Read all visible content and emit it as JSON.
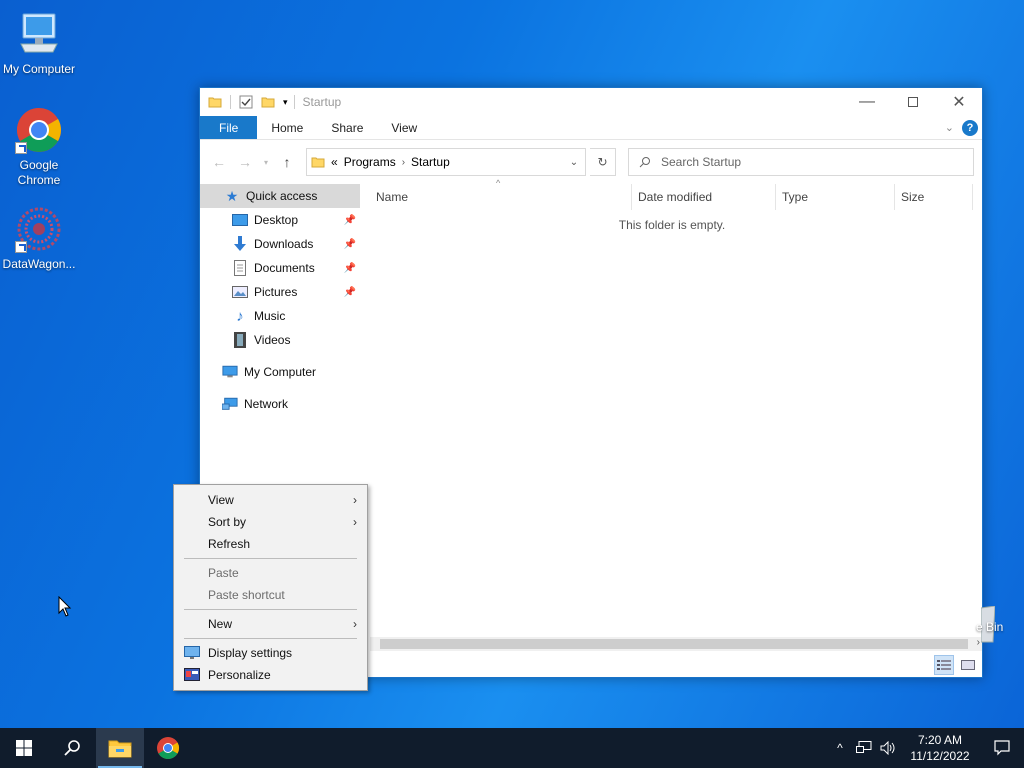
{
  "desktop": {
    "icons": [
      {
        "label": "My Computer"
      },
      {
        "label": "Google Chrome"
      },
      {
        "label": "DataWagon..."
      }
    ],
    "recycle_bin_peek": "e Bin"
  },
  "explorer": {
    "title": "Startup",
    "ribbon_tabs": [
      "File",
      "Home",
      "Share",
      "View"
    ],
    "help_label": "?",
    "breadcrumb": {
      "overflow": "«",
      "parent": "Programs",
      "current": "Startup"
    },
    "search_placeholder": "Search Startup",
    "nav": {
      "quick_access": "Quick access",
      "desktop": "Desktop",
      "downloads": "Downloads",
      "documents": "Documents",
      "pictures": "Pictures",
      "music": "Music",
      "videos": "Videos",
      "my_computer": "My Computer",
      "network": "Network"
    },
    "columns": [
      "Name",
      "Date modified",
      "Type",
      "Size"
    ],
    "empty_message": "This folder is empty."
  },
  "context_menu": {
    "view": "View",
    "sort_by": "Sort by",
    "refresh": "Refresh",
    "paste": "Paste",
    "paste_shortcut": "Paste shortcut",
    "new": "New",
    "display_settings": "Display settings",
    "personalize": "Personalize"
  },
  "taskbar": {
    "time": "7:20 AM",
    "date": "11/12/2022"
  },
  "colors": {
    "accent": "#1979ca",
    "taskbar": "#101c2c",
    "selected_nav": "#d9d9d9"
  }
}
